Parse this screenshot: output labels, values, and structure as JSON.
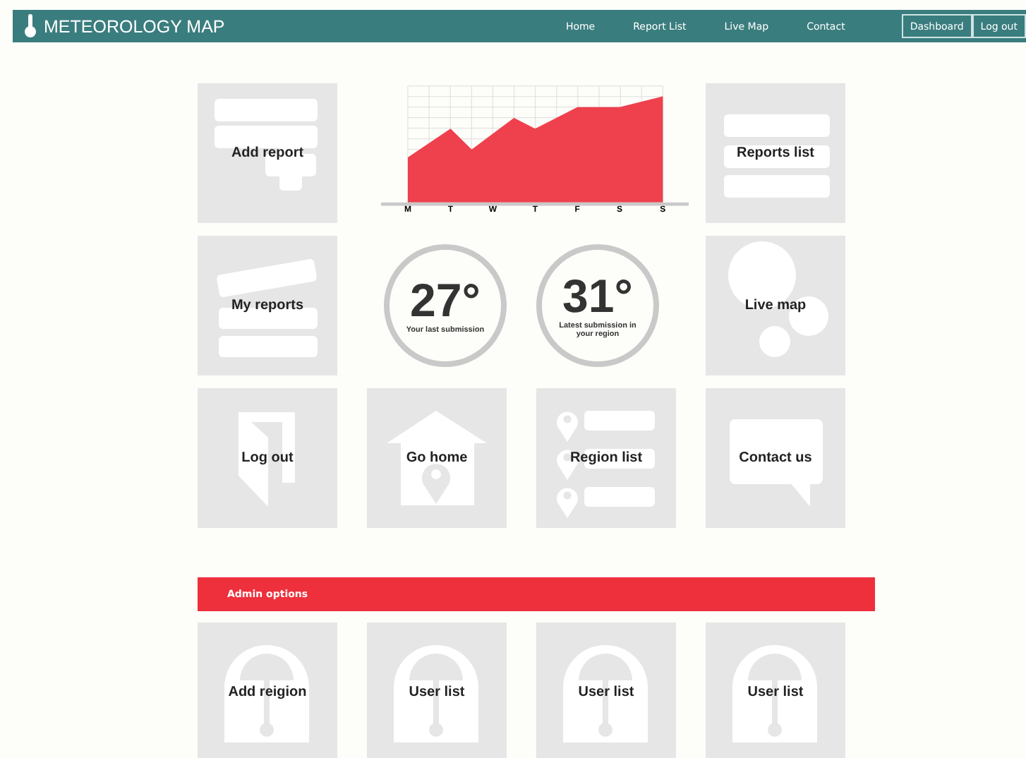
{
  "header": {
    "title": "METEOROLOGY MAP",
    "nav": [
      "Home",
      "Report List",
      "Live Map",
      "Contact"
    ],
    "buttons": [
      "Dashboard",
      "Log out"
    ]
  },
  "chart": {
    "days": [
      "M",
      "T",
      "W",
      "T",
      "F",
      "S",
      "S"
    ]
  },
  "gauges": [
    {
      "value": "27°",
      "caption": "Your last submission"
    },
    {
      "value": "31°",
      "caption": "Latest submission in your region"
    }
  ],
  "tiles": [
    {
      "label": "Add report",
      "kind": "add"
    },
    {
      "label": "Reports list",
      "kind": "list"
    },
    {
      "label": "My reports",
      "kind": "stack"
    },
    {
      "label": "Live map",
      "kind": "map"
    },
    {
      "label": "Log out",
      "kind": "door"
    },
    {
      "label": "Go home",
      "kind": "house"
    },
    {
      "label": "Region list",
      "kind": "pins"
    },
    {
      "label": "Contact us",
      "kind": "bubble"
    }
  ],
  "admin": {
    "title": "Admin options",
    "tiles": [
      {
        "label": "Add reigion",
        "kind": "lock"
      },
      {
        "label": "User list",
        "kind": "lock"
      },
      {
        "label": "User list",
        "kind": "lock"
      },
      {
        "label": "User list",
        "kind": "lock"
      }
    ]
  }
}
